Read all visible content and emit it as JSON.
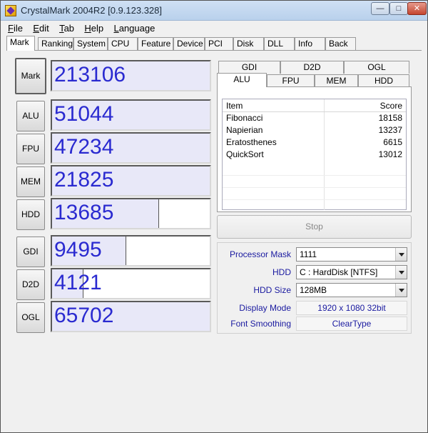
{
  "window": {
    "title": "CrystalMark 2004R2 [0.9.123.328]",
    "controls": {
      "minimize": "—",
      "maximize": "□",
      "close": "✕"
    }
  },
  "menu": [
    "File",
    "Edit",
    "Tab",
    "Help",
    "Language"
  ],
  "tabs": [
    "Mark",
    "Ranking",
    "System",
    "CPU",
    "Feature",
    "Device",
    "PCI",
    "Disk",
    "DLL",
    "Info",
    "Back"
  ],
  "active_tab": "Mark",
  "scores": [
    {
      "label": "Mark",
      "value": "213106",
      "fill": 1.0
    },
    {
      "label": "ALU",
      "value": "51044",
      "fill": 1.0
    },
    {
      "label": "FPU",
      "value": "47234",
      "fill": 1.0
    },
    {
      "label": "MEM",
      "value": "21825",
      "fill": 1.0
    },
    {
      "label": "HDD",
      "value": "13685",
      "fill": 0.68
    },
    {
      "label": "GDI",
      "value": "9495",
      "fill": 0.47
    },
    {
      "label": "D2D",
      "value": "4121",
      "fill": 0.2
    },
    {
      "label": "OGL",
      "value": "65702",
      "fill": 1.0
    }
  ],
  "subtabs_top": [
    "GDI",
    "D2D",
    "OGL"
  ],
  "subtabs_bottom": [
    "ALU",
    "FPU",
    "MEM",
    "HDD"
  ],
  "active_subtab": "ALU",
  "results": {
    "headers": {
      "item": "Item",
      "score": "Score"
    },
    "rows": [
      {
        "item": "Fibonacci",
        "score": "18158"
      },
      {
        "item": "Napierian",
        "score": "13237"
      },
      {
        "item": "Eratosthenes",
        "score": "6615"
      },
      {
        "item": "QuickSort",
        "score": "13012"
      }
    ]
  },
  "stop_label": "Stop",
  "settings": {
    "processor_mask": {
      "label": "Processor Mask",
      "value": "1111"
    },
    "hdd": {
      "label": "HDD",
      "value": "C : HardDisk [NTFS]"
    },
    "hdd_size": {
      "label": "HDD Size",
      "value": "128MB"
    },
    "display_mode": {
      "label": "Display Mode",
      "value": "1920 x 1080 32bit"
    },
    "font_smoothing": {
      "label": "Font Smoothing",
      "value": "ClearType"
    }
  },
  "colors": {
    "score_text": "#2a2ad0",
    "label_text": "#1a1aa0",
    "bar_fill": "#e8e8f8"
  }
}
